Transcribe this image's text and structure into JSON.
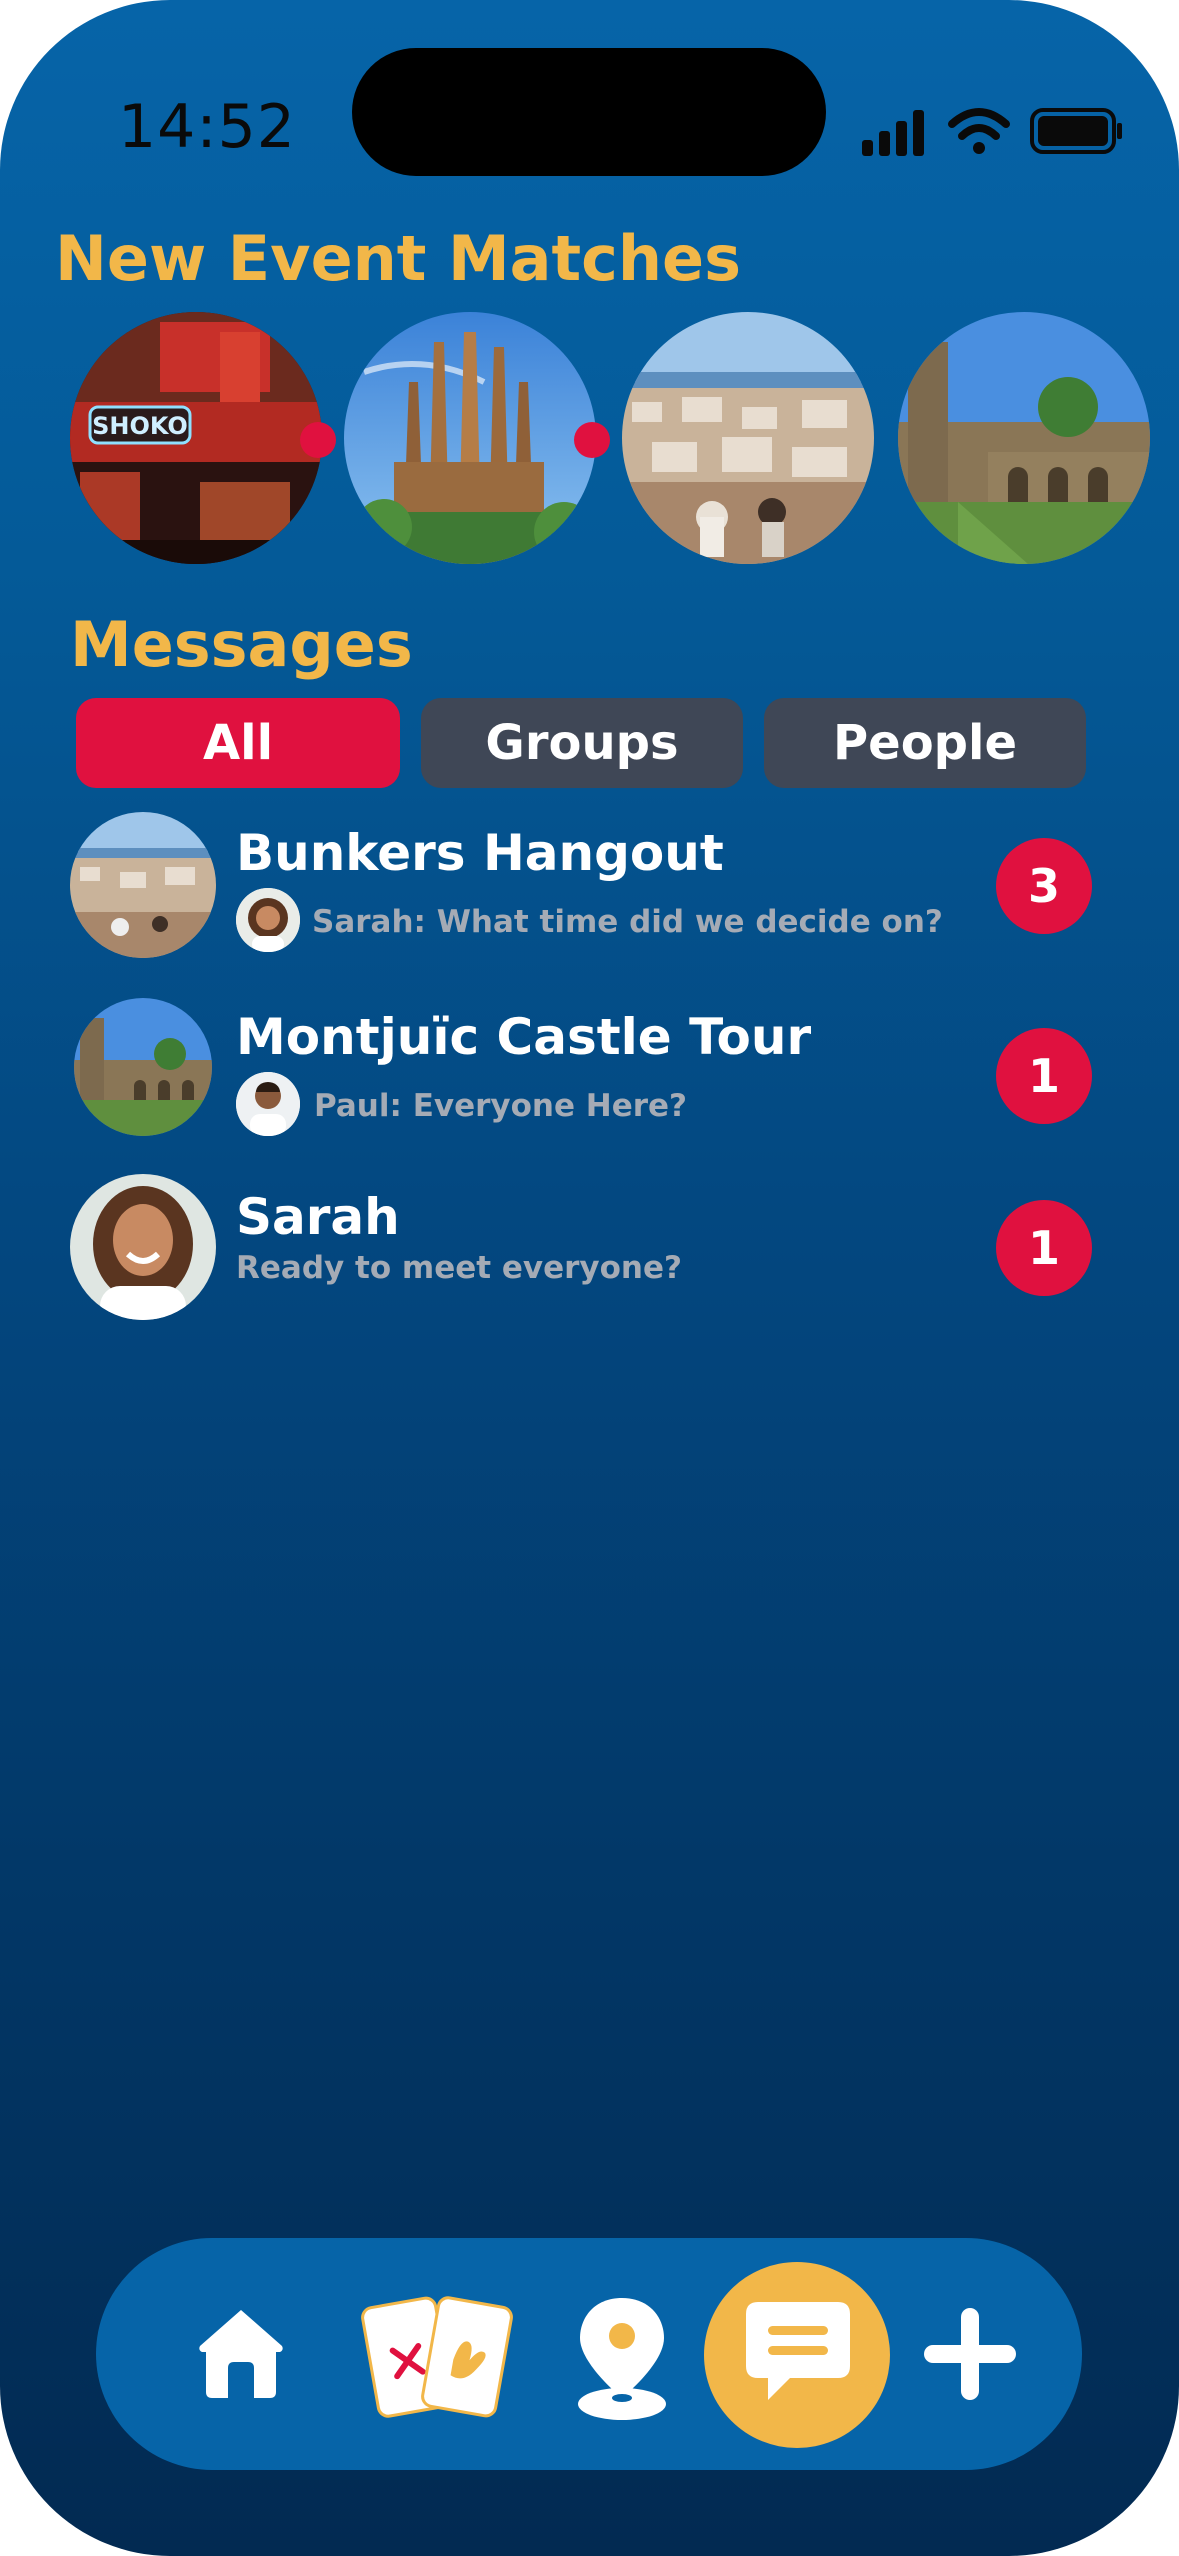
{
  "status_bar": {
    "time": "14:52",
    "icons": [
      "signal-icon",
      "wifi-icon",
      "battery-icon"
    ]
  },
  "matches": {
    "title": "New Event Matches",
    "items": [
      {
        "name": "shoko-restaurant-photo",
        "sign_text": "SHOKO",
        "unread": true
      },
      {
        "name": "sagrada-familia-photo",
        "unread": true
      },
      {
        "name": "bunkers-city-view-photo",
        "unread": false
      },
      {
        "name": "montjuic-castle-photo",
        "unread": false
      }
    ]
  },
  "messages": {
    "title": "Messages",
    "tabs": [
      {
        "label": "All",
        "active": true
      },
      {
        "label": "Groups",
        "active": false
      },
      {
        "label": "People",
        "active": false
      }
    ],
    "conversations": [
      {
        "name": "Bunkers Hangout",
        "preview": "Sarah: What time did we decide on?",
        "badge": "3",
        "thumb": "city-view",
        "sender_avatar": "sarah"
      },
      {
        "name": "Montjuïc Castle Tour",
        "preview": "Paul: Everyone Here?",
        "badge": "1",
        "thumb": "castle",
        "sender_avatar": "paul"
      },
      {
        "name": "Sarah",
        "preview": "Ready to meet everyone?",
        "badge": "1",
        "thumb": "sarah",
        "sender_avatar": null
      }
    ]
  },
  "bottom_nav": {
    "items": [
      "home-icon",
      "swipe-cards-icon",
      "map-pin-icon",
      "chat-icon",
      "plus-icon"
    ],
    "active": "chat-icon"
  },
  "colors": {
    "accent_yellow": "#f2b749",
    "accent_red": "#e0113f",
    "nav_blue": "#0664a8",
    "tab_inactive": "#3f4756",
    "preview_gray": "#a5abb5"
  }
}
